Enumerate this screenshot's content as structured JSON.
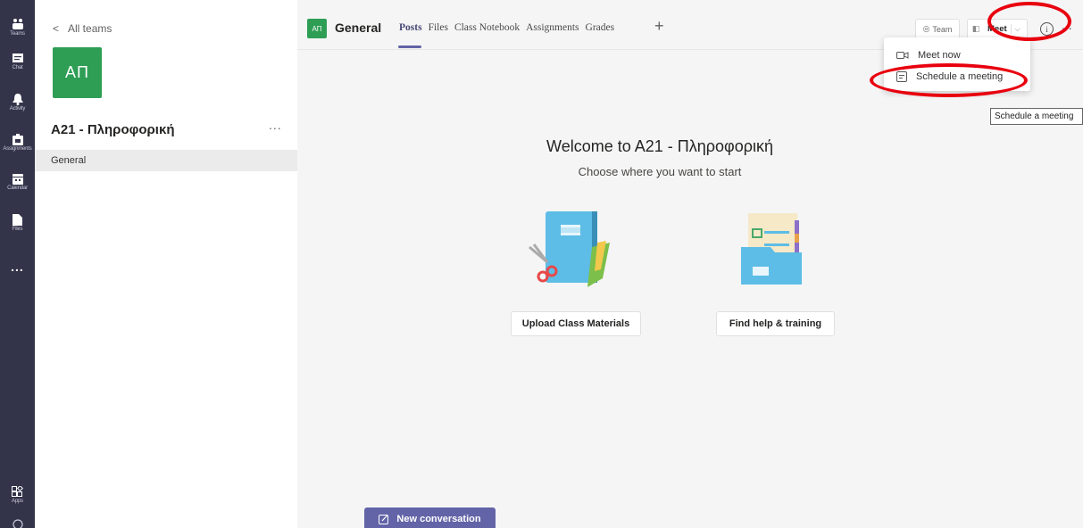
{
  "rail": {
    "items": [
      {
        "label": "Teams"
      },
      {
        "label": "Chat"
      },
      {
        "label": "Activity"
      },
      {
        "label": "Assignments"
      },
      {
        "label": "Calendar"
      },
      {
        "label": "Files"
      }
    ],
    "more": "...",
    "apps": "Apps"
  },
  "team_pane": {
    "back_label": "All teams",
    "avatar_initials": "ΑΠ",
    "team_name": "A21 - Πληροφορική",
    "more": "...",
    "channels": [
      "General"
    ]
  },
  "header": {
    "avatar_initials": "ΑΠ",
    "channel_title": "General",
    "tabs": [
      "Posts",
      "Files",
      "Class Notebook",
      "Assignments",
      "Grades"
    ],
    "active_tab": "Posts",
    "add_tab": "+",
    "team_button": "Team",
    "meet_button": "Meet",
    "info_icon": "i",
    "more": "..."
  },
  "meet_menu": {
    "items": [
      {
        "label": "Meet now",
        "icon": "video-camera-icon"
      },
      {
        "label": "Schedule a meeting",
        "icon": "calendar-icon"
      }
    ],
    "tooltip": "Schedule a meeting"
  },
  "welcome": {
    "title": "Welcome to A21 - Πληροφορική",
    "subtitle": "Choose where you want to start",
    "upload_button": "Upload Class Materials",
    "help_button": "Find help & training"
  },
  "composer": {
    "new_conversation": "New conversation"
  },
  "colors": {
    "rail": "#33344a",
    "accent": "#6264a7",
    "team_green": "#2e9e55",
    "annotation_red": "#e8000e"
  }
}
